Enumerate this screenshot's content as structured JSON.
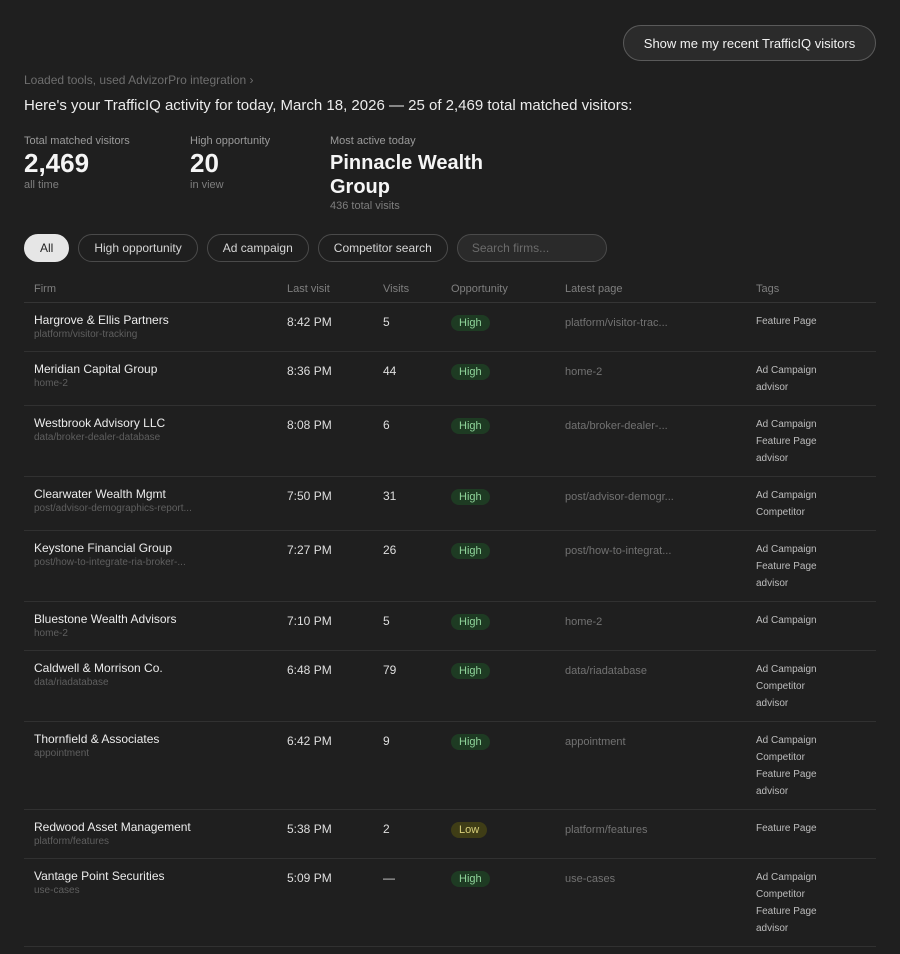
{
  "header": {
    "cta_label": "Show me my recent TrafficIQ visitors",
    "breadcrumb": "Loaded tools, used AdvizorPro integration ›",
    "headline": "Here's your TrafficIQ activity for today, March 18, 2026 — 25 of 2,469 total matched visitors:"
  },
  "stats": {
    "total": {
      "label": "Total matched visitors",
      "value": "2,469",
      "sub": "all time"
    },
    "high": {
      "label": "High opportunity",
      "value": "20",
      "sub": "in view"
    },
    "active": {
      "label": "Most active today",
      "value": "Pinnacle Wealth Group",
      "sub": "436 total visits"
    }
  },
  "filters": {
    "all": "All",
    "high": "High opportunity",
    "ad": "Ad campaign",
    "competitor": "Competitor search",
    "search_placeholder": "Search firms..."
  },
  "table": {
    "headers": {
      "firm": "Firm",
      "last": "Last visit",
      "visits": "Visits",
      "opp": "Opportunity",
      "page": "Latest page",
      "tags": "Tags"
    },
    "rows": [
      {
        "firm": "Hargrove & Ellis Partners",
        "path": "platform/visitor-tracking",
        "last": "8:42 PM",
        "visits": "5",
        "opp": "High",
        "page": "platform/visitor-trac...",
        "tags": [
          "Feature Page"
        ]
      },
      {
        "firm": "Meridian Capital Group",
        "path": "home-2",
        "last": "8:36 PM",
        "visits": "44",
        "opp": "High",
        "page": "home-2",
        "tags": [
          "Ad Campaign",
          "advisor"
        ]
      },
      {
        "firm": "Westbrook Advisory LLC",
        "path": "data/broker-dealer-database",
        "last": "8:08 PM",
        "visits": "6",
        "opp": "High",
        "page": "data/broker-dealer-...",
        "tags": [
          "Ad Campaign",
          "Feature Page",
          "advisor"
        ]
      },
      {
        "firm": "Clearwater Wealth Mgmt",
        "path": "post/advisor-demographics-report...",
        "last": "7:50 PM",
        "visits": "31",
        "opp": "High",
        "page": "post/advisor-demogr...",
        "tags": [
          "Ad Campaign",
          "Competitor"
        ]
      },
      {
        "firm": "Keystone Financial Group",
        "path": "post/how-to-integrate-ria-broker-...",
        "last": "7:27 PM",
        "visits": "26",
        "opp": "High",
        "page": "post/how-to-integrat...",
        "tags": [
          "Ad Campaign",
          "Feature Page",
          "advisor"
        ]
      },
      {
        "firm": "Bluestone Wealth Advisors",
        "path": "home-2",
        "last": "7:10 PM",
        "visits": "5",
        "opp": "High",
        "page": "home-2",
        "tags": [
          "Ad Campaign"
        ]
      },
      {
        "firm": "Caldwell & Morrison Co.",
        "path": "data/riadatabase",
        "last": "6:48 PM",
        "visits": "79",
        "opp": "High",
        "page": "data/riadatabase",
        "tags": [
          "Ad Campaign",
          "Competitor",
          "advisor"
        ]
      },
      {
        "firm": "Thornfield & Associates",
        "path": "appointment",
        "last": "6:42 PM",
        "visits": "9",
        "opp": "High",
        "page": "appointment",
        "tags": [
          "Ad Campaign",
          "Competitor",
          "Feature Page",
          "advisor"
        ]
      },
      {
        "firm": "Redwood Asset Management",
        "path": "platform/features",
        "last": "5:38 PM",
        "visits": "2",
        "opp": "Low",
        "page": "platform/features",
        "tags": [
          "Feature Page"
        ]
      },
      {
        "firm": "Vantage Point Securities",
        "path": "use-cases",
        "last": "5:09 PM",
        "visits": "—",
        "opp": "High",
        "page": "use-cases",
        "tags": [
          "Ad Campaign",
          "Competitor",
          "Feature Page",
          "advisor"
        ]
      }
    ]
  }
}
